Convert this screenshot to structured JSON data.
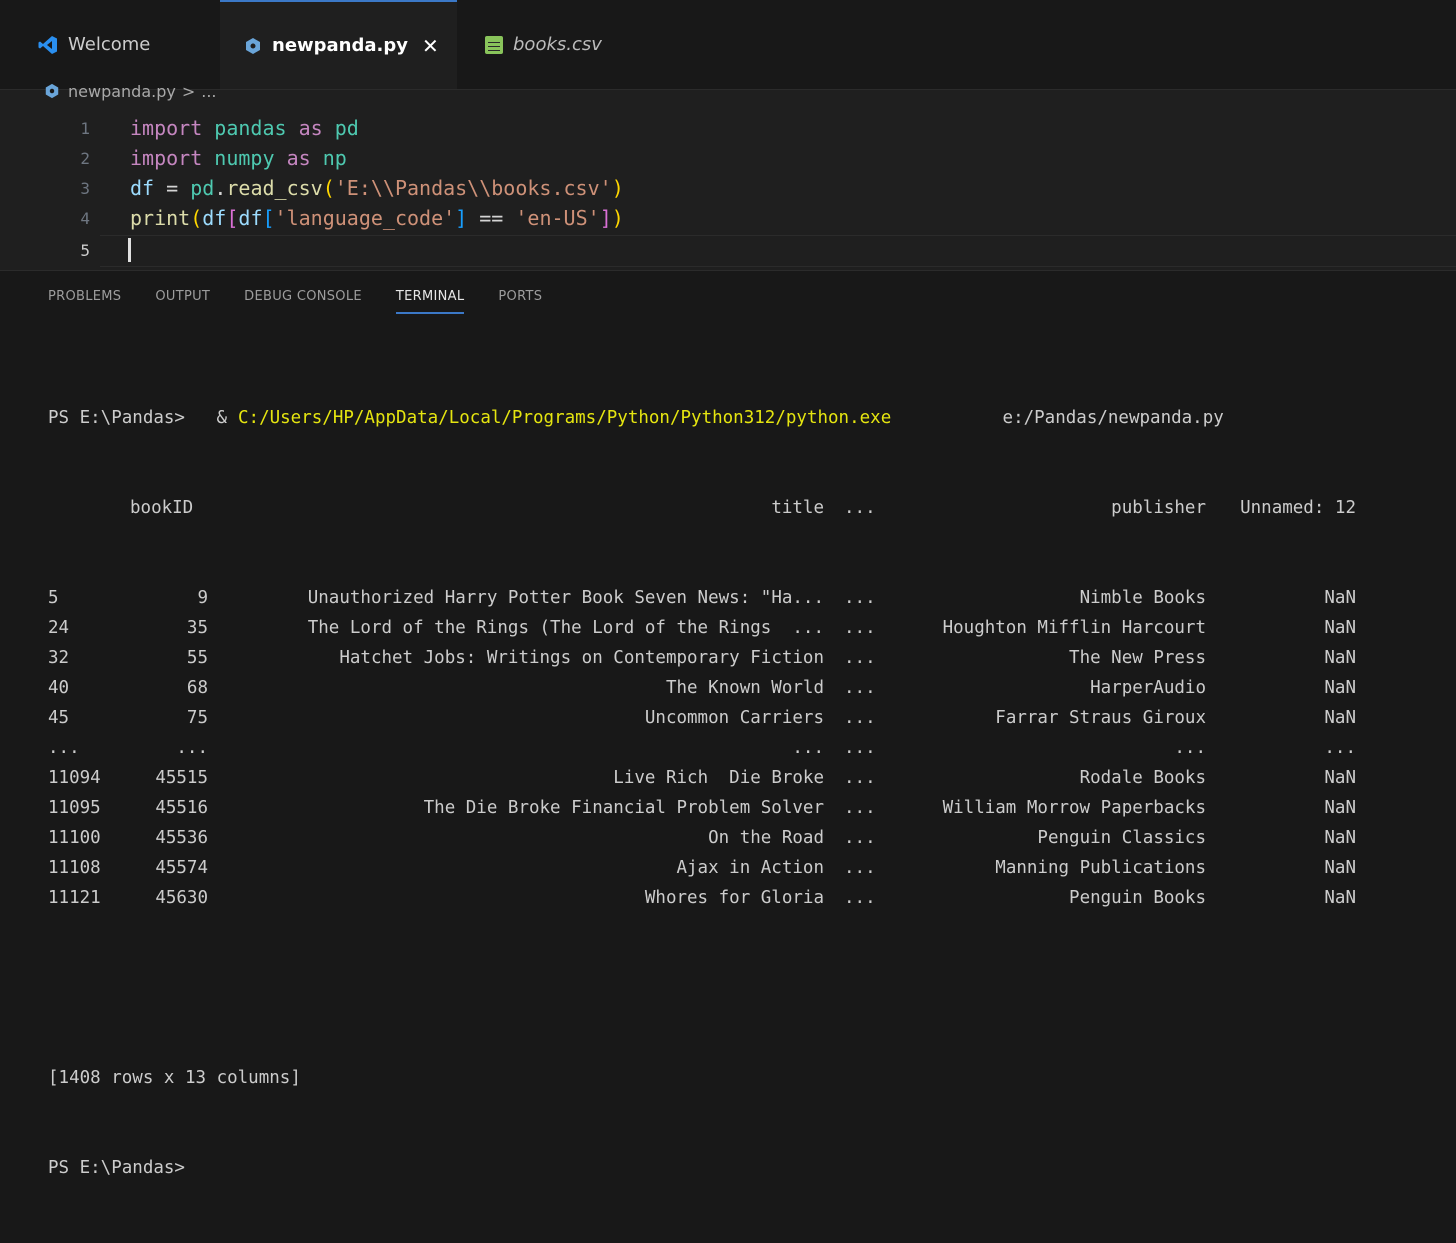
{
  "tabs": [
    {
      "label": "Welcome",
      "icon": "vscode-logo-icon"
    },
    {
      "label": "newpanda.py",
      "icon": "python-file-icon",
      "active": true,
      "close": "✕"
    },
    {
      "label": "books.csv",
      "icon": "csv-file-icon"
    }
  ],
  "breadcrumb": {
    "file": "newpanda.py",
    "sep": ">",
    "rest": "..."
  },
  "editor": {
    "lines": [
      {
        "num": "1"
      },
      {
        "num": "2"
      },
      {
        "num": "3"
      },
      {
        "num": "4"
      },
      {
        "num": "5"
      }
    ],
    "code": {
      "l1": {
        "kw1": "import",
        "mod": "pandas",
        "kw2": "as",
        "alias": "pd"
      },
      "l2": {
        "kw1": "import",
        "mod": "numpy",
        "kw2": "as",
        "alias": "np"
      },
      "l3": {
        "var": "df",
        "eq": " = ",
        "obj": "pd",
        "dot": ".",
        "fn": "read_csv",
        "open": "(",
        "str": "'E:\\\\Pandas\\\\books.csv'",
        "close": ")"
      },
      "l4": {
        "fn": "print",
        "open1": "(",
        "df1": "df",
        "open2": "[",
        "df2": "df",
        "open3": "[",
        "str1": "'language_code'",
        "close3": "]",
        "op": " == ",
        "str2": "'en-US'",
        "close2": "]",
        "close1": ")"
      }
    }
  },
  "panel": {
    "tabs": [
      "PROBLEMS",
      "OUTPUT",
      "DEBUG CONSOLE",
      "TERMINAL",
      "PORTS"
    ],
    "active_tab": "TERMINAL"
  },
  "terminal": {
    "cmd": {
      "prompt": "PS E:\\Pandas>",
      "amp": " & ",
      "exe": "C:/Users/HP/AppData/Local/Programs/Python/Python312/python.exe",
      "arg": " e:/Pandas/newpanda.py"
    },
    "header": {
      "bookID": "bookID",
      "title": "title",
      "ell": "...",
      "publisher": "publisher",
      "unnamed": "Unnamed: 12"
    },
    "rows": [
      {
        "idx": "5",
        "id": "9",
        "title": "Unauthorized Harry Potter Book Seven News: \"Ha...",
        "ell": "...",
        "pub": "Nimble Books",
        "un": "NaN"
      },
      {
        "idx": "24",
        "id": "35",
        "title": "The Lord of the Rings (The Lord of the Rings  ...",
        "ell": "...",
        "pub": "Houghton Mifflin Harcourt",
        "un": "NaN"
      },
      {
        "idx": "32",
        "id": "55",
        "title": "Hatchet Jobs: Writings on Contemporary Fiction",
        "ell": "...",
        "pub": "The New Press",
        "un": "NaN"
      },
      {
        "idx": "40",
        "id": "68",
        "title": "The Known World",
        "ell": "...",
        "pub": "HarperAudio",
        "un": "NaN"
      },
      {
        "idx": "45",
        "id": "75",
        "title": "Uncommon Carriers",
        "ell": "...",
        "pub": "Farrar Straus Giroux",
        "un": "NaN"
      },
      {
        "idx": "...",
        "id": "...",
        "title": "...",
        "ell": "...",
        "pub": "...",
        "un": "..."
      },
      {
        "idx": "11094",
        "id": "45515",
        "title": "Live Rich  Die Broke",
        "ell": "...",
        "pub": "Rodale Books",
        "un": "NaN"
      },
      {
        "idx": "11095",
        "id": "45516",
        "title": "The Die Broke Financial Problem Solver",
        "ell": "...",
        "pub": "William Morrow Paperbacks",
        "un": "NaN"
      },
      {
        "idx": "11100",
        "id": "45536",
        "title": "On the Road",
        "ell": "...",
        "pub": "Penguin Classics",
        "un": "NaN"
      },
      {
        "idx": "11108",
        "id": "45574",
        "title": "Ajax in Action",
        "ell": "...",
        "pub": "Manning Publications",
        "un": "NaN"
      },
      {
        "idx": "11121",
        "id": "45630",
        "title": "Whores for Gloria",
        "ell": "...",
        "pub": "Penguin Books",
        "un": "NaN"
      }
    ],
    "summary": "[1408 rows x 13 columns]",
    "final_prompt": "PS E:\\Pandas>"
  }
}
